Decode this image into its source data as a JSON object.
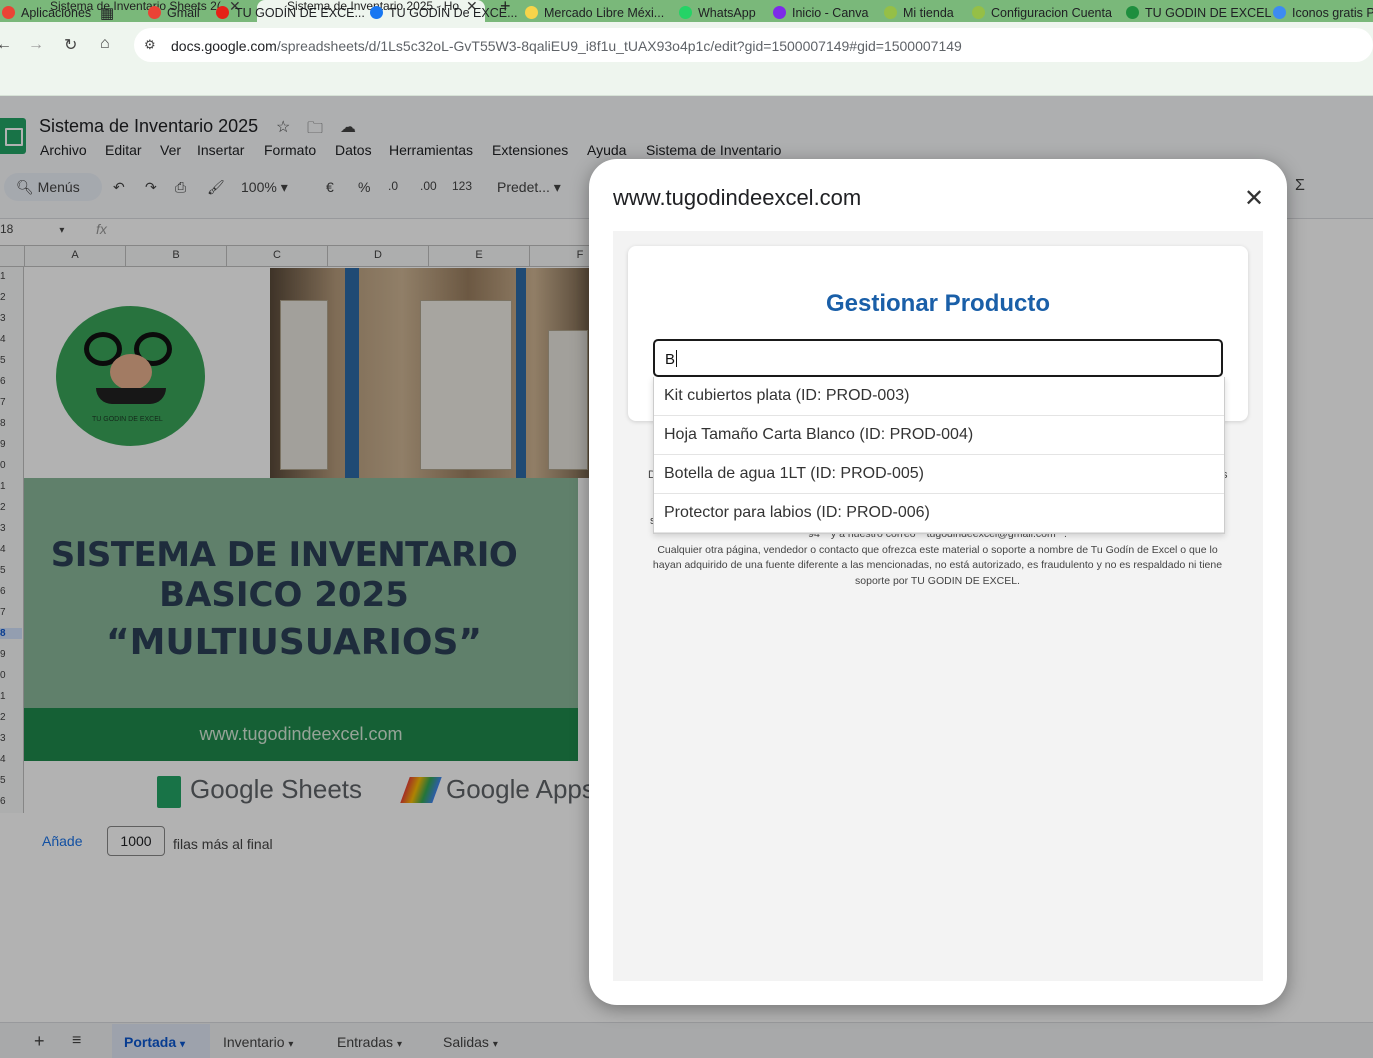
{
  "browser": {
    "tabs": [
      {
        "title": "Sistema de Inventario Sheets 2("
      },
      {
        "title": "Sistema de Inventario 2025 - Ho"
      }
    ],
    "url_host": "docs.google.com",
    "url_path": "/spreadsheets/d/1Ls5c32oL-GvT55W3-8qaliEU9_i8f1u_tUAX93o4p1c/edit?gid=1500007149#gid=1500007149",
    "bookmarks": [
      {
        "label": "Aplicaciones",
        "color": "#ea4335"
      },
      {
        "label": "Gmail",
        "color": "#ea4335"
      },
      {
        "label": "TU GODÍN DE EXCE...",
        "color": "#e62117"
      },
      {
        "label": "TU GODÍN De EXCE...",
        "color": "#1877f2"
      },
      {
        "label": "Mercado Libre Méxi...",
        "color": "#f7d44a"
      },
      {
        "label": "WhatsApp",
        "color": "#25d366"
      },
      {
        "label": "Inicio - Canva",
        "color": "#7d2ae8"
      },
      {
        "label": "Mi tienda",
        "color": "#95bf47"
      },
      {
        "label": "Configuracion Cuenta",
        "color": "#95bf47"
      },
      {
        "label": "TU GODIN DE EXCEL",
        "color": "#1e8e3e"
      },
      {
        "label": "Iconos gratis Pl",
        "color": "#3d8bf2"
      }
    ]
  },
  "sheets": {
    "doc_title": "Sistema de Inventario 2025",
    "menus": [
      "Archivo",
      "Editar",
      "Ver",
      "Insertar",
      "Formato",
      "Datos",
      "Herramientas",
      "Extensiones",
      "Ayuda",
      "Sistema de Inventario"
    ],
    "search_menus": "Menús",
    "zoom": "100%",
    "currency": "€",
    "percent": "%",
    "dec_down": ".0",
    "dec_up": ".00",
    "num_format": "123",
    "font": "Predet...",
    "sum": "Σ",
    "name_box": "18",
    "fx": "fx",
    "columns": [
      "A",
      "B",
      "C",
      "D",
      "E",
      "F"
    ],
    "rows": [
      "1",
      "2",
      "3",
      "4",
      "5",
      "6",
      "7",
      "8",
      "9",
      "0",
      "1",
      "2",
      "3",
      "4",
      "5",
      "6",
      "7",
      "8",
      "9",
      "0",
      "1",
      "2",
      "3",
      "4",
      "5",
      "6"
    ],
    "cover": {
      "logo_text": "TU GODIN DE EXCEL",
      "title_line1": "SISTEMA DE INVENTARIO",
      "title_line2": "BASICO 2025",
      "title_line3": "“MULTIUSUARIOS”",
      "website": "www.tugodindeexcel.com",
      "brand1": "Google Sheets",
      "brand2": "Google Apps"
    },
    "add_rows": {
      "link": "Añade",
      "value": "1000",
      "suffix": "filas más al final"
    },
    "sheet_tabs": [
      "Portada",
      "Inventario",
      "Entradas",
      "Salidas"
    ],
    "active_sheet": "Portada"
  },
  "modal": {
    "header": "www.tugodindeexcel.com",
    "card_title": "Gestionar Producto",
    "search_value": "B",
    "suggestions": [
      "Kit cubiertos plata (ID: PROD-003)",
      "Hoja Tamaño Carta Blanco (ID: PROD-004)",
      "Botella de agua 1LT (ID: PROD-005)",
      "Protector para labios (ID: PROD-006)"
    ],
    "disclaimer_line1": "94** y a nuestro correo **tugodindeexcel@gmail.com**.",
    "disclaimer_line2": "Cualquier otra página, vendedor o contacto que ofrezca este material o soporte a nombre de Tu Godín de Excel o que lo hayan adquirido de una fuente diferente a las mencionadas, no está autorizado, es fraudulento y no es respaldado ni tiene soporte por TU GODIN DE EXCEL."
  }
}
